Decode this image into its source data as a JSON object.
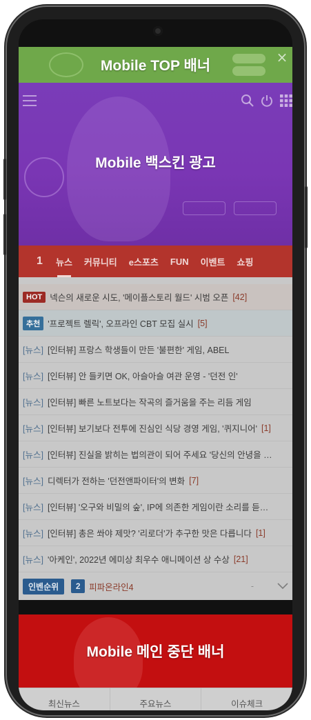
{
  "top_banner": {
    "label": "Mobile TOP 배너"
  },
  "backskin": {
    "label": "Mobile 백스킨 광고"
  },
  "header_icons": [
    "menu-icon",
    "search-icon",
    "power-icon",
    "grid-icon"
  ],
  "nav": {
    "logo": "1",
    "items": [
      "뉴스",
      "커뮤니티",
      "e스포츠",
      "FUN",
      "이벤트",
      "쇼핑"
    ],
    "active": "뉴스"
  },
  "news": {
    "hot": {
      "tag": "HOT",
      "title": "넥슨의 새로운 시도, '메이플스토리 월드' 시범 오픈",
      "count": "[42]"
    },
    "recommended": {
      "tag": "추천",
      "title": "'프로젝트 렐릭', 오프라인 CBT 모집 실시",
      "count": "[5]"
    },
    "items": [
      {
        "category": "[뉴스]",
        "title": "[인터뷰] 프랑스 학생들이 만든 '불편한' 게임, ABEL",
        "count": ""
      },
      {
        "category": "[뉴스]",
        "title": "[인터뷰] 안 들키면 OK, 아슬아슬 여관 운영 - '던전 인'",
        "count": ""
      },
      {
        "category": "[뉴스]",
        "title": "[인터뷰] 빠른 노트보다는 작곡의 즐거움을 주는 리듬 게임",
        "count": ""
      },
      {
        "category": "[뉴스]",
        "title": "[인터뷰] 보기보다 전투에 진심인 식당 경영 게임, '퀴지니어'",
        "count": "[1]"
      },
      {
        "category": "[뉴스]",
        "title": "[인터뷰] 진실을 밝히는 법의관이 되어 주세요 '당신의 안녕을 …",
        "count": ""
      },
      {
        "category": "[뉴스]",
        "title": "디렉터가 전하는 '던전앤파이터'의 변화",
        "count": "[7]"
      },
      {
        "category": "[뉴스]",
        "title": "[인터뷰] '오구와 비밀의 숲', IP에 의존한 게임이란 소리를 듣…",
        "count": ""
      },
      {
        "category": "[뉴스]",
        "title": "[인터뷰] 총은 쏴야 제맛? '리로더'가 추구한 맛은 다릅니다",
        "count": "[1]"
      },
      {
        "category": "[뉴스]",
        "title": "'아케인', 2022년 에미상 최우수 애니메이션 상 수상",
        "count": "[21]"
      }
    ]
  },
  "ranking": {
    "badge": "인벤순위",
    "rank": "2",
    "name": "피파온라인4",
    "change": "-"
  },
  "mid_banner": {
    "label": "Mobile 메인 중단 배너"
  },
  "bottom_tabs": [
    "최신뉴스",
    "주요뉴스",
    "이슈체크"
  ],
  "colors": {
    "top_banner": "#6fa84a",
    "backskin": "#7a3cb8",
    "nav": "#b3342c",
    "mid_banner": "#c30f10"
  }
}
